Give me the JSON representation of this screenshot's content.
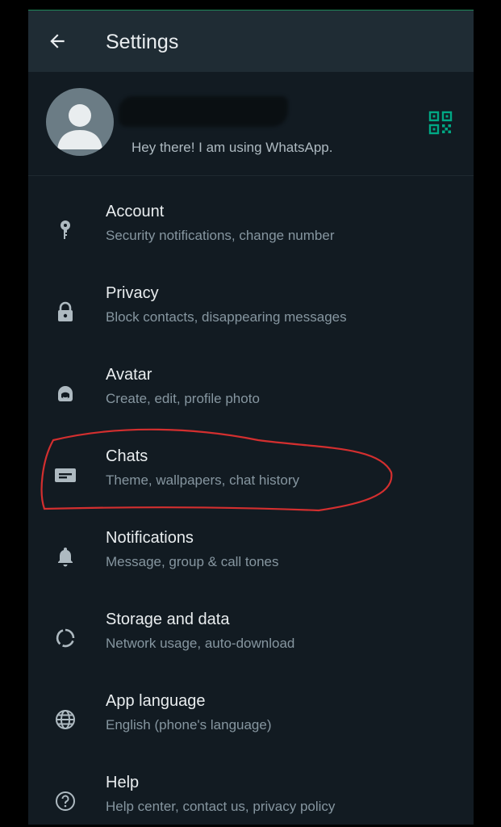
{
  "header": {
    "back_icon": "arrow-left-icon",
    "title": "Settings"
  },
  "profile": {
    "avatar_icon": "default-avatar-icon",
    "status": "Hey there! I am using WhatsApp.",
    "qr_icon": "qr-code-icon"
  },
  "menu": {
    "items": [
      {
        "label": "Account",
        "subtitle": "Security notifications, change number",
        "icon": "key-icon"
      },
      {
        "label": "Privacy",
        "subtitle": "Block contacts, disappearing messages",
        "icon": "lock-icon"
      },
      {
        "label": "Avatar",
        "subtitle": "Create, edit, profile photo",
        "icon": "avatar-face-icon"
      },
      {
        "label": "Chats",
        "subtitle": "Theme, wallpapers, chat history",
        "icon": "chat-icon"
      },
      {
        "label": "Notifications",
        "subtitle": "Message, group & call tones",
        "icon": "bell-icon"
      },
      {
        "label": "Storage and data",
        "subtitle": "Network usage, auto-download",
        "icon": "storage-circle-icon"
      },
      {
        "label": "App language",
        "subtitle": "English (phone's language)",
        "icon": "globe-icon"
      },
      {
        "label": "Help",
        "subtitle": "Help center, contact us, privacy policy",
        "icon": "help-circle-icon"
      }
    ]
  },
  "colors": {
    "background": "#121b22",
    "appbar": "#1f2c34",
    "primary_text": "#e9edef",
    "secondary_text": "#8696a0",
    "accent": "#00a884",
    "annotation": "#d32f2f"
  }
}
